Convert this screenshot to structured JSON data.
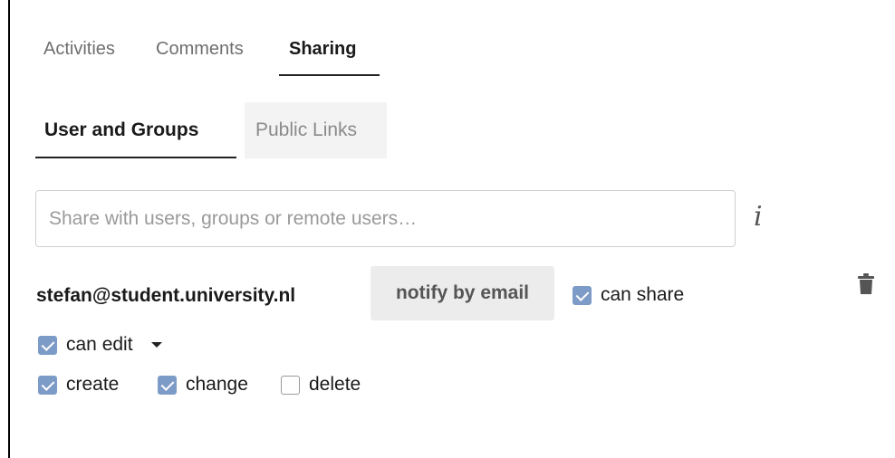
{
  "tabs": [
    {
      "label": "Activities",
      "active": false
    },
    {
      "label": "Comments",
      "active": false
    },
    {
      "label": "Sharing",
      "active": true
    }
  ],
  "sharing": {
    "subtabs": [
      {
        "label": "User and Groups",
        "active": true
      },
      {
        "label": "Public Links",
        "active": false
      }
    ],
    "search": {
      "placeholder": "Share with users, groups or remote users…",
      "value": ""
    },
    "info_icon": "i",
    "entry": {
      "user": "stefan@student.university.nl",
      "notify_label": "notify by email",
      "can_share": {
        "label": "can share",
        "checked": true
      },
      "can_edit": {
        "label": "can edit",
        "checked": true
      },
      "create": {
        "label": "create",
        "checked": true
      },
      "change": {
        "label": "change",
        "checked": true
      },
      "delete": {
        "label": "delete",
        "checked": false
      },
      "trash_icon": "trash-icon"
    }
  },
  "colors": {
    "checkbox_checked": "#7d9bc7",
    "notify_button_bg": "#ececec",
    "inactive_subtab_bg": "#f3f3f3"
  }
}
